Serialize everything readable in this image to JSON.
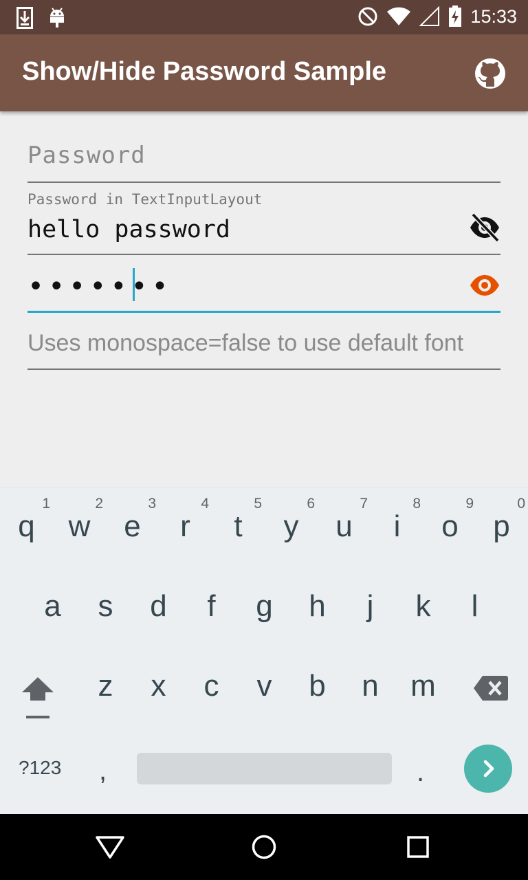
{
  "status_bar": {
    "time": "15:33",
    "icons": [
      "download-icon",
      "android-icon",
      "do-not-disturb-icon",
      "wifi-icon",
      "signal-icon",
      "battery-charging-icon"
    ]
  },
  "app_bar": {
    "title": "Show/Hide Password Sample",
    "action_icon": "github-icon"
  },
  "form": {
    "field1": {
      "placeholder": "Password"
    },
    "field2": {
      "floating_label": "Password in TextInputLayout",
      "value": "hello password",
      "toggle_icon": "eye-off-icon"
    },
    "field3": {
      "value_masked": "•••••••",
      "toggle_icon": "eye-icon"
    },
    "field4": {
      "placeholder": "Uses monospace=false to use default font"
    }
  },
  "keyboard": {
    "row1": [
      {
        "ch": "q",
        "hint": "1"
      },
      {
        "ch": "w",
        "hint": "2"
      },
      {
        "ch": "e",
        "hint": "3"
      },
      {
        "ch": "r",
        "hint": "4"
      },
      {
        "ch": "t",
        "hint": "5"
      },
      {
        "ch": "y",
        "hint": "6"
      },
      {
        "ch": "u",
        "hint": "7"
      },
      {
        "ch": "i",
        "hint": "8"
      },
      {
        "ch": "o",
        "hint": "9"
      },
      {
        "ch": "p",
        "hint": "0"
      }
    ],
    "row2": [
      "a",
      "s",
      "d",
      "f",
      "g",
      "h",
      "j",
      "k",
      "l"
    ],
    "row3": [
      "z",
      "x",
      "c",
      "v",
      "b",
      "n",
      "m"
    ],
    "symbols_label": "?123",
    "comma": ",",
    "period": ".",
    "icons": [
      "shift-icon",
      "backspace-icon",
      "enter-arrow-icon"
    ]
  },
  "nav_bar": {
    "icons": [
      "back-icon",
      "home-icon",
      "recents-icon"
    ]
  },
  "colors": {
    "status_bar": "#5d4037",
    "app_bar": "#795548",
    "accent": "#26a6c8",
    "eye_active": "#e65100",
    "enter_key": "#4db6ac"
  }
}
